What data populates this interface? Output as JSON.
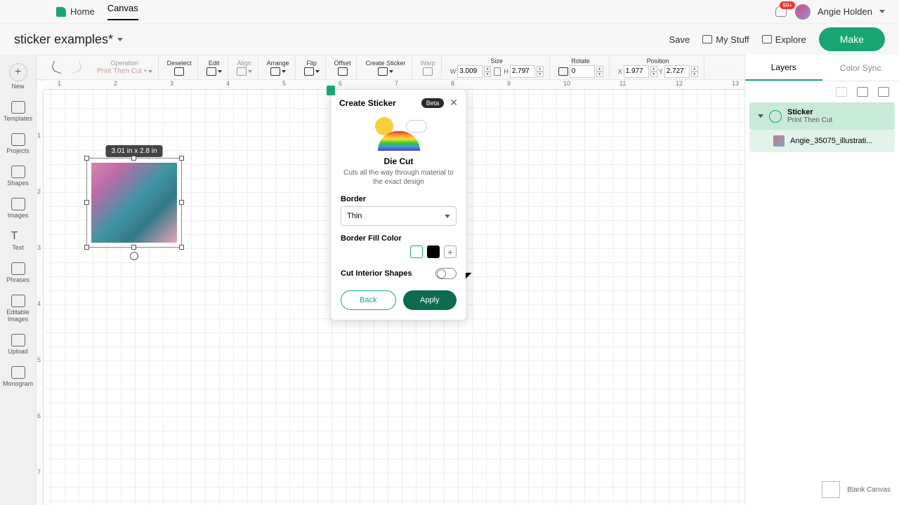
{
  "topbar": {
    "home": "Home",
    "canvas": "Canvas",
    "notif_count": "99+",
    "username": "Angie Holden"
  },
  "project": {
    "name": "sticker examples*"
  },
  "secondbar": {
    "save": "Save",
    "mystuff": "My Stuff",
    "explore": "Explore",
    "make": "Make"
  },
  "toolbar": {
    "operation": {
      "lbl": "Operation",
      "val": "Print Then Cut •"
    },
    "deselect": "Deselect",
    "edit": "Edit",
    "align": "Align",
    "arrange": "Arrange",
    "flip": "Flip",
    "offset": "Offset",
    "create_sticker": "Create Sticker",
    "warp": "Warp",
    "size": {
      "lbl": "Size",
      "w_pre": "W",
      "w": "3.009",
      "h_pre": "H",
      "h": "2.797"
    },
    "rotate": {
      "lbl": "Rotate",
      "val": "0"
    },
    "position": {
      "lbl": "Position",
      "x_pre": "X",
      "x": "1.977",
      "y_pre": "Y",
      "y": "2.727"
    }
  },
  "leftbar": {
    "new": "New",
    "templates": "Templates",
    "projects": "Projects",
    "shapes": "Shapes",
    "images": "Images",
    "text": "Text",
    "phrases": "Phrases",
    "editable": "Editable\nImages",
    "upload": "Upload",
    "monogram": "Monogram"
  },
  "ruler_h": [
    "1",
    "2",
    "3",
    "4",
    "5",
    "6",
    "7",
    "8",
    "9",
    "10",
    "11",
    "12",
    "13"
  ],
  "ruler_v": [
    "1",
    "2",
    "3",
    "4",
    "5",
    "6",
    "7"
  ],
  "selection": {
    "dim_label": "3.01 in x 2.8 in"
  },
  "popup": {
    "title": "Create Sticker",
    "beta": "Beta",
    "cut_title": "Die Cut",
    "cut_desc": "Cuts all the way through material to the exact design",
    "border_lbl": "Border",
    "border_val": "Thin",
    "fill_lbl": "Border Fill Color",
    "interior_lbl": "Cut Interior Shapes",
    "back": "Back",
    "apply": "Apply"
  },
  "rightpanel": {
    "tab_layers": "Layers",
    "tab_colorsync": "Color Sync",
    "layer_name": "Sticker",
    "layer_sub": "Print Then Cut",
    "child_name": "Angie_35075_illustrati..."
  },
  "footer": {
    "blank": "Blank Canvas"
  }
}
